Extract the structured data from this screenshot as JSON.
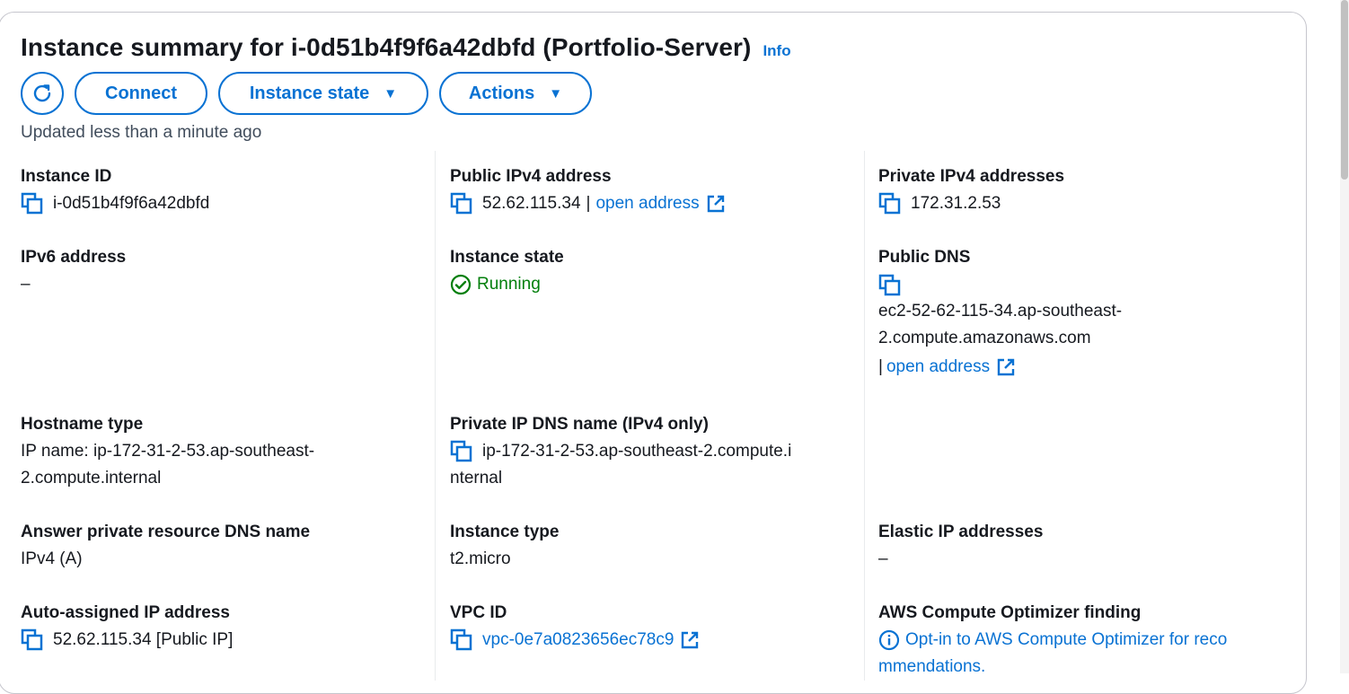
{
  "header": {
    "title": "Instance summary for i-0d51b4f9f6a42dbfd (Portfolio-Server)",
    "info": "Info"
  },
  "buttons": {
    "connect": "Connect",
    "instance_state": "Instance state",
    "actions": "Actions"
  },
  "updated": "Updated less than a minute ago",
  "fields": {
    "instance_id": {
      "label": "Instance ID",
      "value": "i-0d51b4f9f6a42dbfd"
    },
    "public_ipv4": {
      "label": "Public IPv4 address",
      "value": "52.62.115.34",
      "sep": "|",
      "link": "open address"
    },
    "private_ipv4": {
      "label": "Private IPv4 addresses",
      "value": "172.31.2.53"
    },
    "ipv6": {
      "label": "IPv6 address",
      "value": "–"
    },
    "instance_state": {
      "label": "Instance state",
      "value": "Running"
    },
    "public_dns": {
      "label": "Public DNS",
      "value_line1": "ec2-52-62-115-34.ap-southeast-",
      "value_line2": "2.compute.amazonaws.com",
      "sep": "|",
      "link": "open address"
    },
    "hostname_type": {
      "label": "Hostname type",
      "value_line1": "IP name: ip-172-31-2-53.ap-southeast-",
      "value_line2": "2.compute.internal"
    },
    "private_ip_dns": {
      "label": "Private IP DNS name (IPv4 only)",
      "value_line1": "ip-172-31-2-53.ap-southeast-2.compute.i",
      "value_line2": "nternal"
    },
    "answer_dns": {
      "label": "Answer private resource DNS name",
      "value": "IPv4 (A)"
    },
    "instance_type": {
      "label": "Instance type",
      "value": "t2.micro"
    },
    "elastic_ip": {
      "label": "Elastic IP addresses",
      "value": "–"
    },
    "auto_ip": {
      "label": "Auto-assigned IP address",
      "value": "52.62.115.34 [Public IP]"
    },
    "vpc_id": {
      "label": "VPC ID",
      "value": "vpc-0e7a0823656ec78c9"
    },
    "optimizer": {
      "label": "AWS Compute Optimizer finding",
      "value_line1": "Opt-in to AWS Compute Optimizer for reco",
      "value_line2": "mmendations."
    }
  },
  "colors": {
    "link": "#0972d3",
    "success": "#037f0c",
    "text": "#16191f",
    "border": "#c6c6cd"
  },
  "icons": {
    "refresh": "refresh-icon",
    "copy": "copy-icon",
    "external": "external-link-icon",
    "status": "status-success-icon",
    "info": "info-circle-icon",
    "caret": "caret-down-icon"
  }
}
